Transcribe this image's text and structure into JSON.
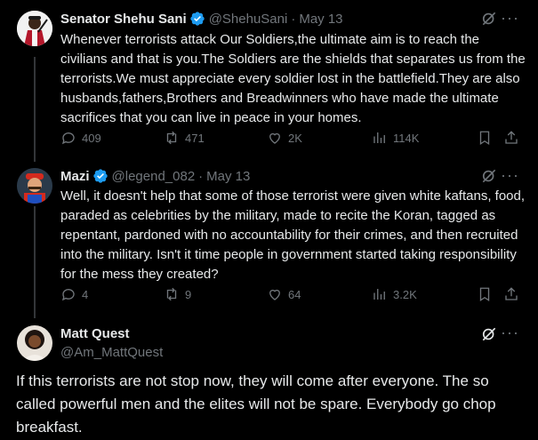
{
  "tweets": [
    {
      "name": "Senator Shehu Sani",
      "handle": "@ShehuSani",
      "dot": "·",
      "date": "May 13",
      "text": "Whenever terrorists attack Our Soldiers,the ultimate aim is to reach the civilians and that is you.The Soldiers are the shields that separates us from the terrorists.We must appreciate every soldier lost in the battlefield.They are also husbands,fathers,Brothers and Breadwinners who have made the ultimate sacrifices that you can live in peace in your homes.",
      "replies": "409",
      "reposts": "471",
      "likes": "2K",
      "views": "114K"
    },
    {
      "name": "Mazi",
      "handle": "@legend_082",
      "dot": "·",
      "date": "May 13",
      "text": "Well, it doesn't help that some of those terrorist were given white kaftans, food, paraded as celebrities by the military, made to recite the Koran, tagged as repentant, pardoned with no accountability for their crimes, and then recruited into the military. Isn't it time people in government started taking responsibility for the mess they created?",
      "replies": "4",
      "reposts": "9",
      "likes": "64",
      "views": "3.2K"
    }
  ],
  "main_tweet": {
    "name": "Matt Quest",
    "handle": "@Am_MattQuest",
    "text": "If this terrorists are not stop now, they will come after everyone. The so called powerful men and the elites will not be spare. Everybody go chop breakfast."
  },
  "icons": {
    "verified": "verified-badge-icon",
    "grok": "grok-icon",
    "more": "more-icon",
    "reply": "reply-icon",
    "repost": "repost-icon",
    "like": "like-icon",
    "views": "views-icon",
    "bookmark": "bookmark-icon",
    "share": "share-icon"
  },
  "colors": {
    "background": "#000000",
    "text": "#e7e9ea",
    "muted": "#71767b",
    "verified": "#1d9bf0",
    "thread_line": "#333639"
  }
}
